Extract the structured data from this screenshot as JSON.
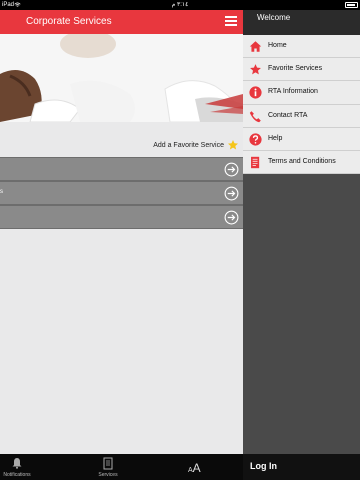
{
  "status_bar": {
    "carrier": "iPad",
    "time": "٣:١٤ م"
  },
  "header": {
    "title": "Corporate Services"
  },
  "favorite": {
    "label": "Add a Favorite Service"
  },
  "services": [
    {
      "label": ""
    },
    {
      "label": "s"
    },
    {
      "label": ""
    }
  ],
  "tab_bar": {
    "notifications": "Notifications",
    "services": "Services",
    "font_small": "A",
    "font_large": "A"
  },
  "menu": {
    "welcome": "Welcome",
    "items": [
      {
        "label": "Home",
        "icon": "home-icon"
      },
      {
        "label": "Favorite Services",
        "icon": "star-icon"
      },
      {
        "label": "RTA Information",
        "icon": "info-icon"
      },
      {
        "label": "Contact RTA",
        "icon": "phone-icon"
      },
      {
        "label": "Help",
        "icon": "help-icon"
      },
      {
        "label": "Terms and Conditions",
        "icon": "document-icon"
      }
    ],
    "login": "Log In"
  },
  "colors": {
    "accent": "#e8373e",
    "menu_bg": "#4a4a4a",
    "star": "#f5c518"
  }
}
